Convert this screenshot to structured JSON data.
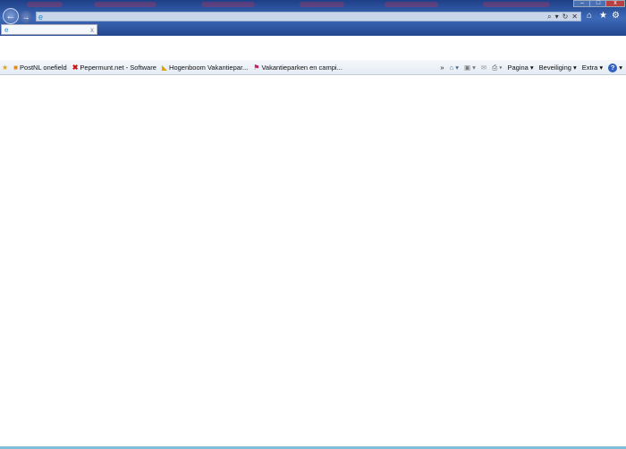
{
  "titlebar": {
    "minimize": "–",
    "maximize": "□",
    "close": "x"
  },
  "address": {
    "value": "",
    "search_icon": "⌕",
    "dropdown": "▾",
    "refresh": "↻",
    "stop": "✕"
  },
  "tab": {
    "title": "",
    "close": "x"
  },
  "toolbar_icons": {
    "home": "⌂",
    "favorites": "★",
    "tools": "⚙"
  },
  "favorites_bar": {
    "items": [
      {
        "label": "PostNL  onefield",
        "icon": "postnl-icon"
      },
      {
        "label": "Pepermunt.net - Software",
        "icon": "red-x-icon"
      },
      {
        "label": "Hogenboom Vakantiepar...",
        "icon": "hogenboom-icon"
      },
      {
        "label": "Vakantieparken en campi...",
        "icon": "vakantieparken-icon"
      }
    ],
    "overflow": "»"
  },
  "command_bar": {
    "page": "Pagina ▾",
    "safety": "Beveiliging ▾",
    "tools": "Extra ▾",
    "help": "?"
  }
}
